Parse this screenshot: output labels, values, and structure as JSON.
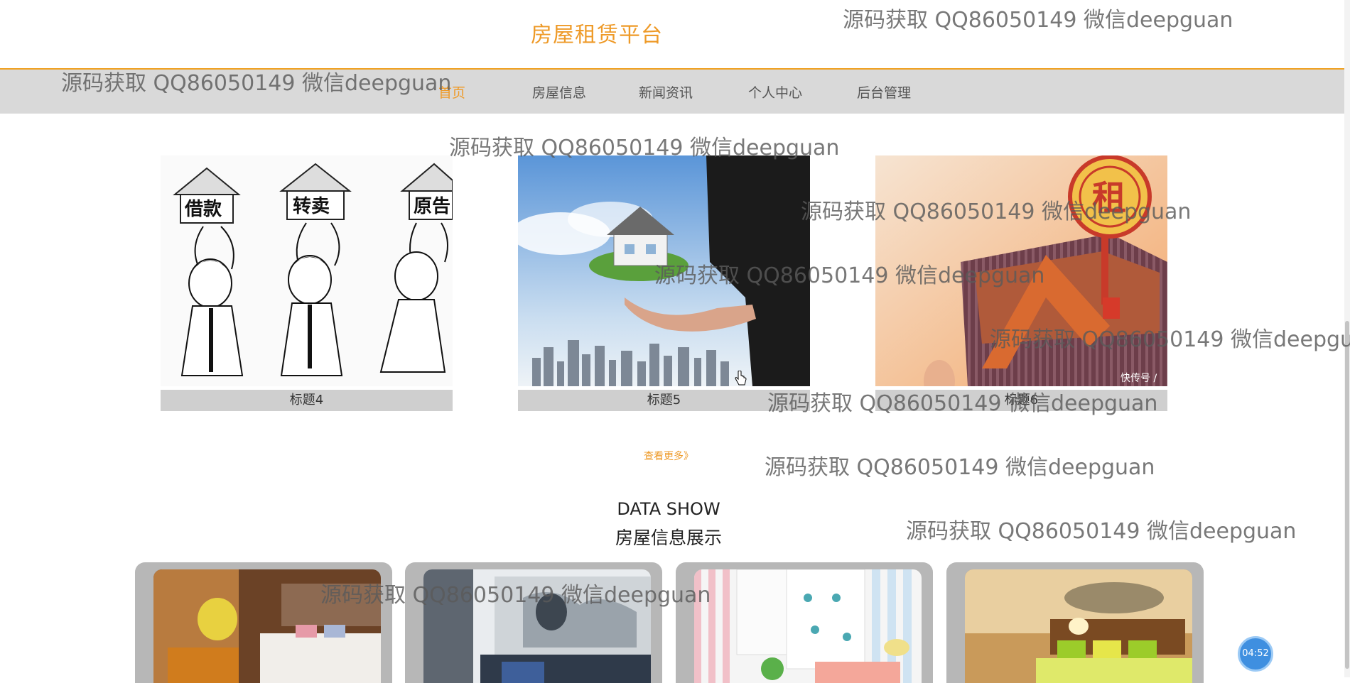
{
  "header": {
    "title": "房屋租赁平台"
  },
  "nav": {
    "items": [
      "首页",
      "房屋信息",
      "新闻资讯",
      "个人中心",
      "后台管理"
    ]
  },
  "news": {
    "cards": [
      {
        "title": "标题4"
      },
      {
        "title": "标题5"
      },
      {
        "title": "标题6"
      }
    ],
    "more_label": "查看更多》",
    "badge": "快传号 /"
  },
  "section": {
    "title_en": "DATA SHOW",
    "title_cn": "房屋信息展示"
  },
  "watermark": "源码获取 QQ86050149 微信deepguan",
  "timer": "04:52",
  "colors": {
    "accent": "#ee9a28",
    "nav_bg": "#d9d9d9",
    "caption_bg": "#cfcfcf",
    "card_frame": "#b7b7b7",
    "timer": "#3f8fe0"
  },
  "icons": [
    "hand-pointer-icon"
  ]
}
